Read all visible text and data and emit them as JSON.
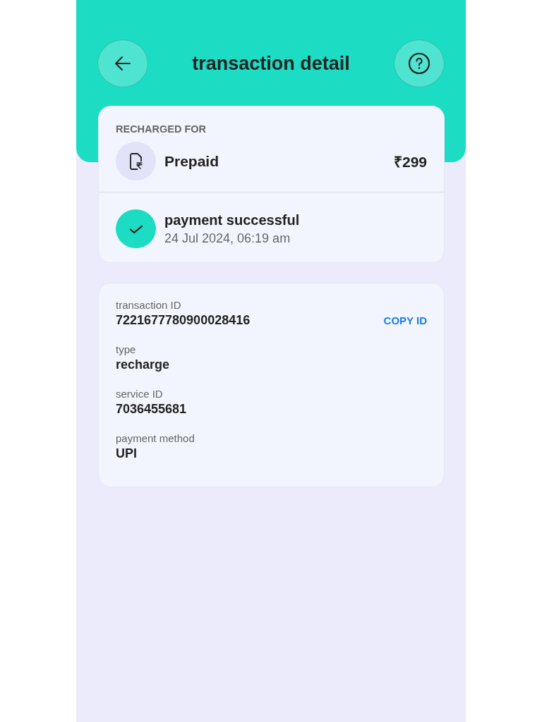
{
  "header": {
    "title": "transaction detail"
  },
  "recharge": {
    "heading": "RECHARGED FOR",
    "plan": "Prepaid",
    "amount": "₹299"
  },
  "payment": {
    "succeeded": true,
    "title": "payment successful",
    "time": "24 Jul 2024, 06:19 am"
  },
  "details": [
    {
      "label": "transaction ID",
      "value": "7221677780900028416",
      "action": "COPY ID"
    },
    {
      "label": "type",
      "value": "recharge"
    },
    {
      "label": "service ID",
      "value": "7036455681"
    },
    {
      "label": "payment method",
      "value": "UPI"
    }
  ]
}
